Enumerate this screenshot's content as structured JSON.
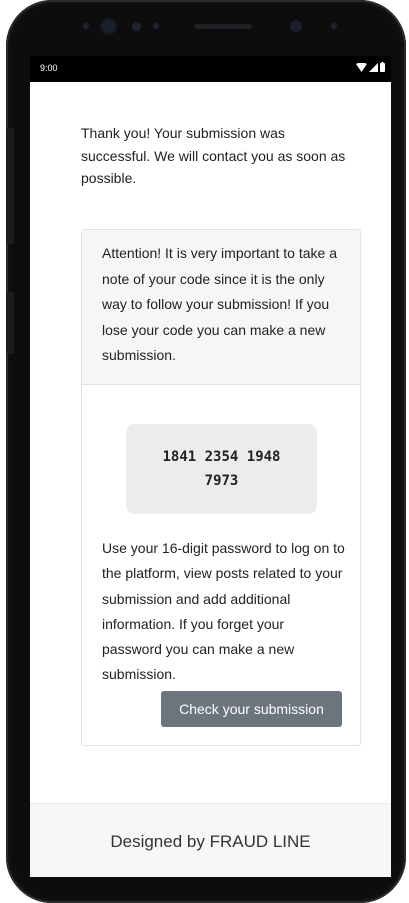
{
  "status_bar": {
    "time": "9:00",
    "icons": [
      "wifi-icon",
      "signal-icon",
      "battery-icon"
    ]
  },
  "intro_text": "Thank you! Your submission was successful. We will contact you as soon as possible.",
  "card": {
    "attention_text": "Attention! It is very important to take a note of your code since it is the only way to follow your submission! If you lose your code you can make a new submission.",
    "code": "1841 2354 1948 7973",
    "info_text": "Use your 16-digit password to log on to the platform, view posts related to your submission and add additional information. If you forget your password you can make a new submission.",
    "button_label": "Check your submission"
  },
  "footer_text": "Designed by FRAUD LINE",
  "colors": {
    "button_bg": "#6c757d",
    "card_header_bg": "#f6f6f6",
    "code_box_bg": "#ececec",
    "footer_bg": "#f7f7f7"
  }
}
